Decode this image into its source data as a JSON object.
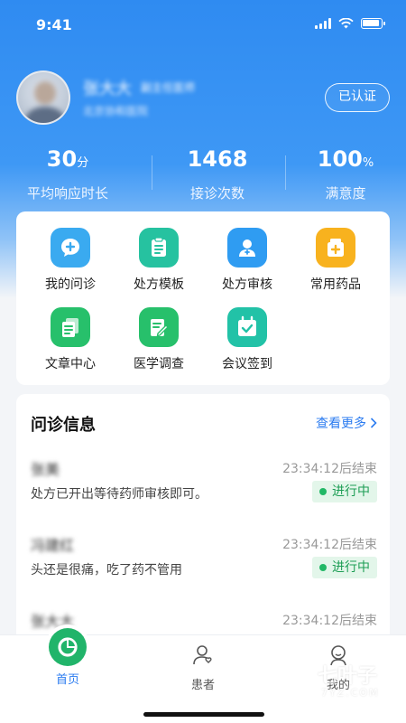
{
  "status_bar": {
    "time": "9:41"
  },
  "profile": {
    "name": "张大大",
    "title": "副主任医师",
    "hospital": "北京协和医院",
    "verified_label": "已认证"
  },
  "stats": [
    {
      "value": "30",
      "unit": "分",
      "label": "平均响应时长"
    },
    {
      "value": "1468",
      "unit": "",
      "label": "接诊次数"
    },
    {
      "value": "100",
      "unit": "%",
      "label": "满意度"
    }
  ],
  "grid": [
    {
      "label": "我的问诊",
      "icon": "chat-plus-icon",
      "color": "#3aaaf0"
    },
    {
      "label": "处方模板",
      "icon": "clipboard-icon",
      "color": "#26c2a0"
    },
    {
      "label": "处方审核",
      "icon": "doctor-badge-icon",
      "color": "#2f9cf2"
    },
    {
      "label": "常用药品",
      "icon": "medicine-box-icon",
      "color": "#f8b21e"
    },
    {
      "label": "文章中心",
      "icon": "documents-icon",
      "color": "#27c06b"
    },
    {
      "label": "医学调查",
      "icon": "survey-edit-icon",
      "color": "#27c06b"
    },
    {
      "label": "会议签到",
      "icon": "calendar-check-icon",
      "color": "#22c2a7"
    }
  ],
  "consult": {
    "title": "问诊信息",
    "see_more": "查看更多",
    "rows": [
      {
        "name": "张美",
        "end_time": "23:34:12后结束",
        "message": "处方已开出等待药师审核即可。",
        "status": "进行中"
      },
      {
        "name": "冯建红",
        "end_time": "23:34:12后结束",
        "message": "头还是很痛，吃了药不管用",
        "status": "进行中"
      },
      {
        "name": "张大大",
        "end_time": "23:34:12后结束",
        "message": "",
        "status": ""
      }
    ]
  },
  "tabs": [
    {
      "label": "首页",
      "active": true
    },
    {
      "label": "患者",
      "active": false
    },
    {
      "label": "我的",
      "active": false
    }
  ],
  "watermark": {
    "text": "七叶子",
    "sub": "7YZ.COM"
  },
  "colors": {
    "primary": "#2c7cf0",
    "success": "#22b866",
    "hero": "#2f8bf1"
  }
}
